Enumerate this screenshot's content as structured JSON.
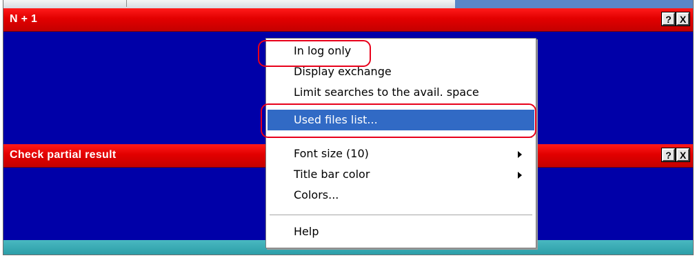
{
  "panel_top": {
    "title": "N + 1",
    "help_glyph": "?",
    "close_glyph": "X"
  },
  "panel_bottom": {
    "title": "Check partial result",
    "help_glyph": "?",
    "close_glyph": "X"
  },
  "context_menu": {
    "items": [
      {
        "label": "In log only"
      },
      {
        "label": "Display exchange"
      },
      {
        "label": "Limit searches to the avail. space"
      },
      {
        "label": "Used files list...",
        "selected": true
      },
      {
        "label": "Font size (10)",
        "submenu": true
      },
      {
        "label": "Title bar color",
        "submenu": true
      },
      {
        "label": "Colors..."
      },
      {
        "label": "Help"
      }
    ]
  },
  "colors": {
    "title_bar": "#e00000",
    "panel_background": "#0000a8",
    "menu_selection": "#316ac5",
    "annotation": "#e8001a",
    "status_strip": "#3aaab3"
  }
}
